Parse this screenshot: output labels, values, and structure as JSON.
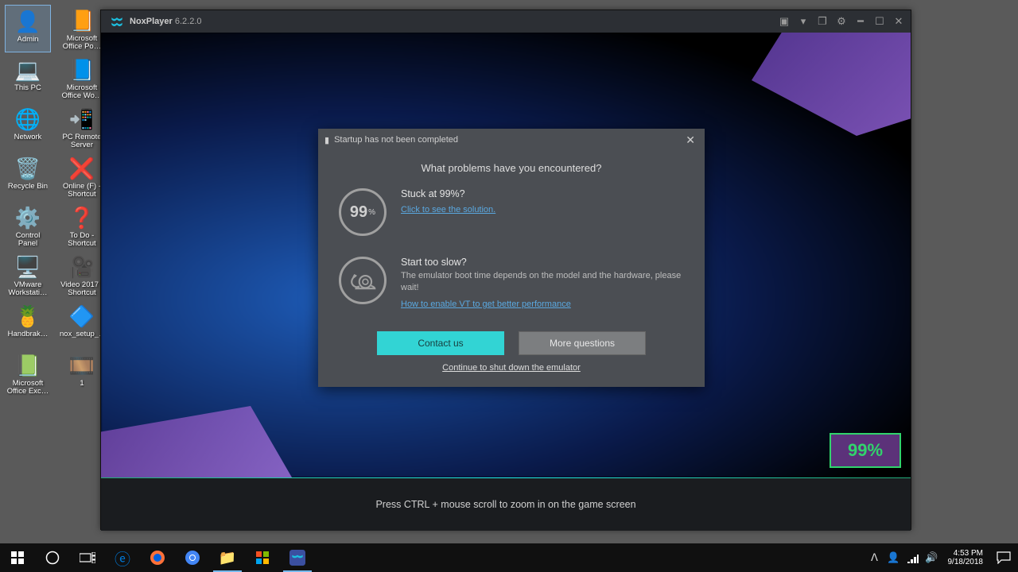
{
  "desktop": {
    "icons": [
      [
        {
          "g": "👤",
          "l": "Admin",
          "sel": true
        },
        {
          "g": "📙",
          "l": "Microsoft Office Po…"
        }
      ],
      [
        {
          "g": "💻",
          "l": "This PC"
        },
        {
          "g": "📘",
          "l": "Microsoft Office Wo…"
        }
      ],
      [
        {
          "g": "🌐",
          "l": "Network"
        },
        {
          "g": "📲",
          "l": "PC Remote Server"
        }
      ],
      [
        {
          "g": "🗑️",
          "l": "Recycle Bin"
        },
        {
          "g": "❌",
          "l": "Online (F) - Shortcut"
        }
      ],
      [
        {
          "g": "⚙️",
          "l": "Control Panel"
        },
        {
          "g": "❓",
          "l": "To Do - Shortcut"
        }
      ],
      [
        {
          "g": "🖥️",
          "l": "VMware Workstati…"
        },
        {
          "g": "🎥",
          "l": "Video 2017 - Shortcut"
        }
      ],
      [
        {
          "g": "🍍",
          "l": "Handbrak…"
        },
        {
          "g": "🔷",
          "l": "nox_setup_…"
        }
      ],
      [
        {
          "g": "📗",
          "l": "Microsoft Office Exc…"
        },
        {
          "g": "🎞️",
          "l": "1"
        }
      ]
    ]
  },
  "nox": {
    "brand": "NoxPlayer",
    "version": "6.2.2.0",
    "loading_pct": "99%",
    "footer": "Press CTRL + mouse scroll to zoom in on the game screen"
  },
  "dialog": {
    "title": "Startup has not been completed",
    "question": "What problems have you encountered?",
    "item1": {
      "pct": "99",
      "pctu": "%",
      "h": "Stuck at 99%?",
      "link": "Click to see the solution."
    },
    "item2": {
      "h": "Start too slow?",
      "p": "The emulator boot time depends on the model and the hardware, please wait!",
      "link": "How to enable VT to get better performance"
    },
    "btn_contact": "Contact us",
    "btn_more": "More questions",
    "shutdown": "Continue to shut down the emulator"
  },
  "taskbar": {
    "clock_time": "4:53 PM",
    "clock_date": "9/18/2018"
  }
}
